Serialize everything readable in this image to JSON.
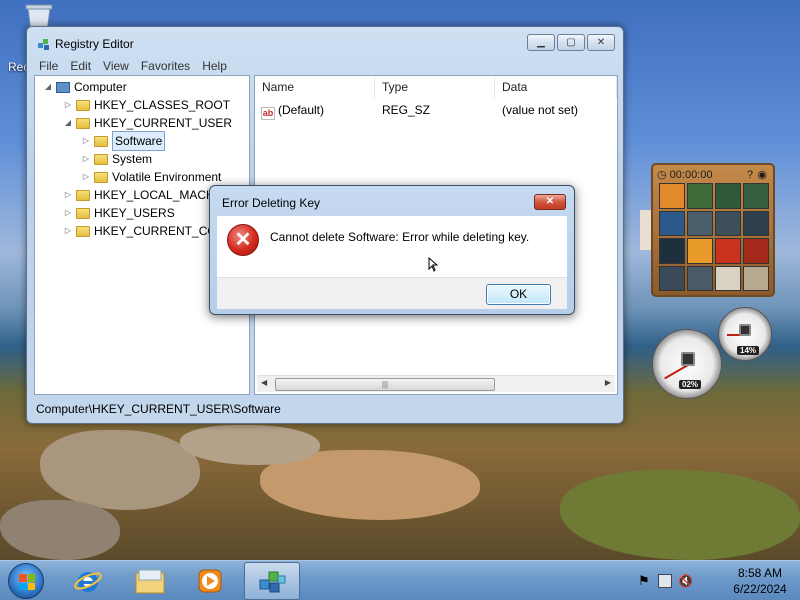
{
  "desktop": {
    "recycle_label": "Recycle Bin"
  },
  "registry_window": {
    "title": "Registry Editor",
    "menu": [
      "File",
      "Edit",
      "View",
      "Favorites",
      "Help"
    ],
    "tree": {
      "root": "Computer",
      "items": [
        {
          "label": "HKEY_CLASSES_ROOT",
          "level": 1,
          "expanded": false
        },
        {
          "label": "HKEY_CURRENT_USER",
          "level": 1,
          "expanded": true
        },
        {
          "label": "Software",
          "level": 2,
          "expanded": false,
          "selected": true
        },
        {
          "label": "System",
          "level": 2,
          "expanded": false
        },
        {
          "label": "Volatile Environment",
          "level": 2,
          "expanded": false
        },
        {
          "label": "HKEY_LOCAL_MACHINE",
          "level": 1,
          "expanded": false
        },
        {
          "label": "HKEY_USERS",
          "level": 1,
          "expanded": false
        },
        {
          "label": "HKEY_CURRENT_CONFIG",
          "level": 1,
          "expanded": false
        }
      ]
    },
    "columns": [
      "Name",
      "Type",
      "Data"
    ],
    "values": [
      {
        "name": "(Default)",
        "type": "REG_SZ",
        "data": "(value not set)"
      }
    ],
    "status_path": "Computer\\HKEY_CURRENT_USER\\Software"
  },
  "dialog": {
    "title": "Error Deleting Key",
    "message": "Cannot delete Software:  Error while deleting key.",
    "ok_label": "OK",
    "close_glyph": "✕"
  },
  "puzzle_gadget": {
    "timer": "00:00:00"
  },
  "cpu_gadget": {
    "cpu_value": "02%",
    "memory_value": "14%"
  },
  "taskbar": {
    "pinned": [
      "internet-explorer",
      "windows-explorer",
      "media-player",
      "registry-editor"
    ],
    "clock_time": "8:58 AM",
    "clock_date": "6/22/2024"
  }
}
